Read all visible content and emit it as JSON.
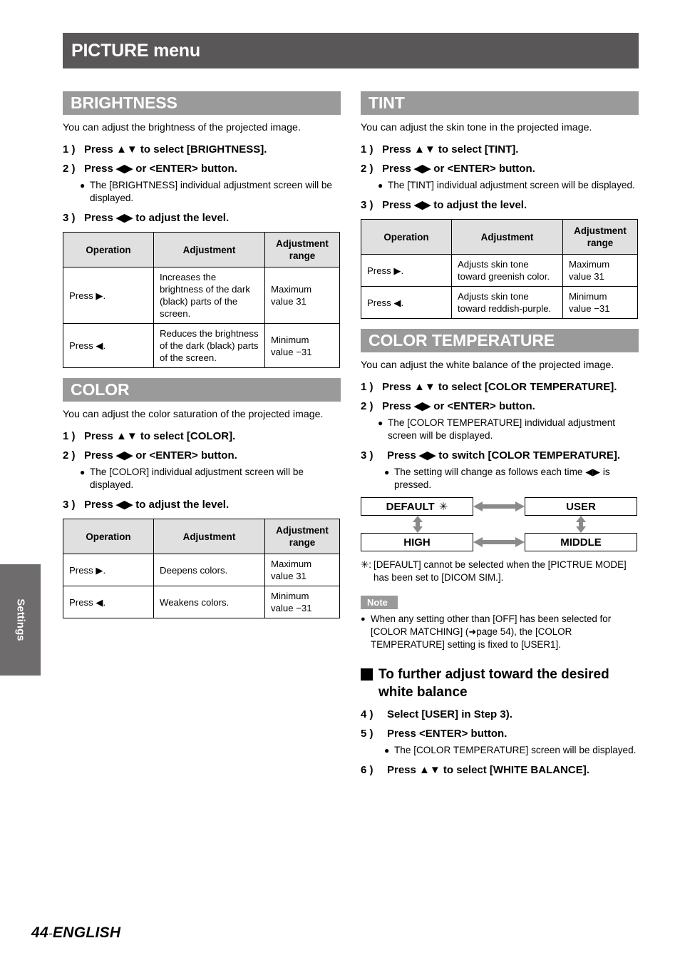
{
  "page": {
    "title": "PICTURE menu",
    "side_tab": "Settings",
    "footer_number": "44",
    "footer_dash": "-",
    "footer_language": "ENGLISH"
  },
  "table_headers": {
    "operation": "Operation",
    "adjustment": "Adjustment",
    "adjustment_range": "Adjustment range"
  },
  "sections": {
    "brightness": {
      "heading": "BRIGHTNESS",
      "intro": "You can adjust the brightness of the projected image.",
      "steps": [
        {
          "num": "1 )",
          "text": "Press ▲▼ to select [BRIGHTNESS]."
        },
        {
          "num": "2 )",
          "text": "Press ◀▶ or <ENTER> button."
        },
        {
          "num": "3 )",
          "text": "Press ◀▶ to adjust the level."
        }
      ],
      "bullet": "The [BRIGHTNESS] individual adjustment screen will be displayed.",
      "rows": [
        {
          "operation": "Press ▶.",
          "adjustment": "Increases the brightness of the dark (black) parts of the screen.",
          "range": "Maximum value 31"
        },
        {
          "operation": "Press ◀.",
          "adjustment": "Reduces the brightness of the dark (black) parts of the screen.",
          "range": "Minimum value −31"
        }
      ]
    },
    "color": {
      "heading": "COLOR",
      "intro": "You can adjust the color saturation of the projected image.",
      "steps": [
        {
          "num": "1 )",
          "text": "Press ▲▼ to select [COLOR]."
        },
        {
          "num": "2 )",
          "text": "Press ◀▶ or <ENTER> button."
        },
        {
          "num": "3 )",
          "text": "Press ◀▶ to adjust the level."
        }
      ],
      "bullet": "The [COLOR] individual adjustment screen will be displayed.",
      "rows": [
        {
          "operation": "Press ▶.",
          "adjustment": "Deepens colors.",
          "range": "Maximum value 31"
        },
        {
          "operation": "Press ◀.",
          "adjustment": "Weakens colors.",
          "range": "Minimum value −31"
        }
      ]
    },
    "tint": {
      "heading": "TINT",
      "intro": "You can adjust the skin tone in the projected image.",
      "steps": [
        {
          "num": "1 )",
          "text": "Press ▲▼ to select [TINT]."
        },
        {
          "num": "2 )",
          "text": "Press ◀▶ or <ENTER> button."
        },
        {
          "num": "3 )",
          "text": "Press ◀▶ to adjust the level."
        }
      ],
      "bullet": "The [TINT] individual adjustment screen will be displayed.",
      "rows": [
        {
          "operation": "Press ▶.",
          "adjustment": "Adjusts skin tone toward greenish color.",
          "range": "Maximum value 31"
        },
        {
          "operation": "Press ◀.",
          "adjustment": "Adjusts skin tone toward reddish-purple.",
          "range": "Minimum value −31"
        }
      ]
    },
    "color_temperature": {
      "heading": "COLOR TEMPERATURE",
      "intro": "You can adjust the white balance of the projected image.",
      "steps": [
        {
          "num": "1 )",
          "text": "Press ▲▼ to select [COLOR TEMPERATURE]."
        },
        {
          "num": "2 )",
          "text": "Press ◀▶ or <ENTER> button."
        },
        {
          "num": "3 )",
          "text": "Press ◀▶ to switch [COLOR TEMPERATURE]."
        },
        {
          "num": "4 )",
          "text": "Select [USER] in Step 3)."
        },
        {
          "num": "5 )",
          "text": "Press <ENTER> button."
        },
        {
          "num": "6 )",
          "text": "Press ▲▼ to select [WHITE BALANCE]."
        }
      ],
      "bullet_step2": "The [COLOR TEMPERATURE] individual adjustment screen will be displayed.",
      "bullet_step3": "The setting will change as follows each time ◀▶ is pressed.",
      "bullet_step5": "The [COLOR TEMPERATURE] screen will be displayed.",
      "flow": {
        "default": "DEFAULT",
        "default_mark": "✳",
        "user": "USER",
        "high": "HIGH",
        "middle": "MIDDLE"
      },
      "asterisk": {
        "mark": "✳:",
        "text": "[DEFAULT] cannot be selected when the [PICTRUE MODE] has been set to [DICOM SIM.]."
      },
      "note": {
        "badge": "Note",
        "text_part1": "When any setting other than [OFF] has been selected for [COLOR MATCHING] (",
        "page_arrow": "➜",
        "page_ref": "page 54",
        "text_part2": "), the [COLOR TEMPERATURE] setting is fixed to [USER1]."
      },
      "sub_heading": "To further adjust toward the desired white balance"
    }
  },
  "colors": {
    "title_bar": "#595757",
    "section_head": "#9b9a9a",
    "side_tab": "#6e6c6c",
    "table_head": "#e0e0e0",
    "arrow": "#8a8a8a"
  }
}
